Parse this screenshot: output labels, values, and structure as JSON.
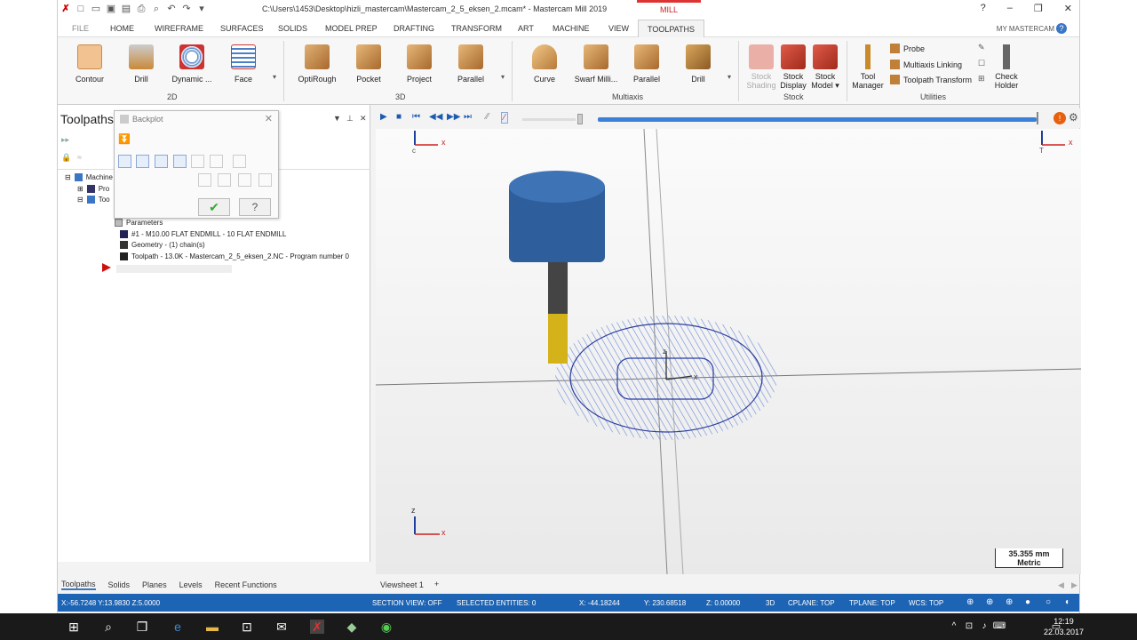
{
  "app": {
    "title": "C:\\Users\\1453\\Desktop\\hizli_mastercam\\Mastercam_2_5_eksen_2.mcam* - Mastercam Mill 2019",
    "context_tab": "MILL",
    "my_mastercam": "MY MASTERCAM"
  },
  "tabs": [
    "FILE",
    "HOME",
    "WIREFRAME",
    "SURFACES",
    "SOLIDS",
    "MODEL PREP",
    "DRAFTING",
    "TRANSFORM",
    "ART",
    "MACHINE",
    "VIEW",
    "TOOLPATHS"
  ],
  "ribbon": {
    "g2d": {
      "label": "2D",
      "buttons": [
        "Contour",
        "Drill",
        "Dynamic ...",
        "Face"
      ]
    },
    "g3d": {
      "label": "3D",
      "buttons": [
        "OptiRough",
        "Pocket",
        "Project",
        "Parallel"
      ]
    },
    "multiaxis": {
      "label": "Multiaxis",
      "buttons": [
        "Curve",
        "Swarf Milli...",
        "Parallel",
        "Drill"
      ]
    },
    "stock": {
      "label": "Stock",
      "shading_1": "Stock",
      "shading_2": "Shading",
      "display_1": "Stock",
      "display_2": "Display",
      "model_1": "Stock",
      "model_2": "Model ▾"
    },
    "utilities": {
      "label": "Utilities",
      "tool_1": "Tool",
      "tool_2": "Manager",
      "probe": "Probe",
      "linking": "Multiaxis Linking",
      "transform": "Toolpath Transform",
      "check_1": "Check",
      "check_2": "Holder"
    }
  },
  "left_panel": {
    "title": "Toolpaths",
    "tree": {
      "machine": "Machine",
      "pro": "Pro",
      "too": "Too",
      "parameters": "Parameters",
      "tool": "#1 - M10.00 FLAT ENDMILL - 10 FLAT ENDMILL",
      "geometry": "Geometry - (1) chain(s)",
      "toolpath": "Toolpath - 13.0K - Mastercam_2_5_eksen_2.NC - Program number 0"
    },
    "bottom_tabs": [
      "Toolpaths",
      "Solids",
      "Planes",
      "Levels",
      "Recent Functions"
    ]
  },
  "backplot": {
    "title": "Backplot"
  },
  "viewport": {
    "tab": "Viewsheet 1",
    "add": "+",
    "scale_value": "35.355 mm",
    "scale_unit": "Metric",
    "axis_x": "x",
    "axis_z": "z",
    "label_c": "c",
    "label_t": "T"
  },
  "status": {
    "coords": "X:-56.7248 Y:13.9830 Z:5.0000",
    "section_view": "SECTION VIEW: OFF",
    "selected": "SELECTED ENTITIES: 0",
    "x": "X:    -44.18244",
    "y": "Y:   230.68518",
    "z": "Z:   0.00000",
    "mode": "3D",
    "cplane": "CPLANE: TOP",
    "tplane": "TPLANE: TOP",
    "wcs": "WCS: TOP"
  },
  "taskbar": {
    "time": "12:19",
    "date": "22.03.2017"
  },
  "colors": {
    "accent": "#1e64b4",
    "tool_body": "#2e5e9c",
    "tool_tip": "#d4b21a",
    "path": "#3a4fb0"
  }
}
